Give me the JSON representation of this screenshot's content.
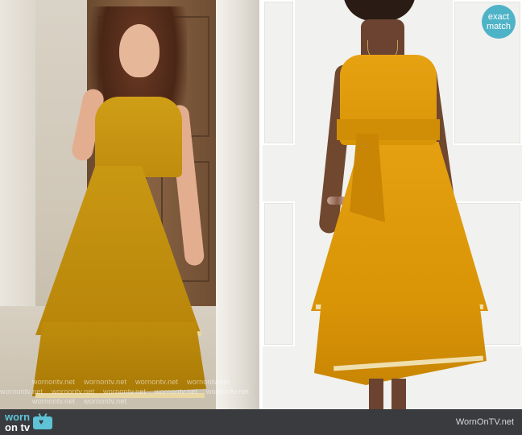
{
  "badge": {
    "line1": "exact",
    "line2": "match"
  },
  "watermark": {
    "text_a": "wornontv.net",
    "text_b": "wornontv.net",
    "text_c": "wornontv.net",
    "text_d": "wornontv.net",
    "text_e": "wornontv.net",
    "text_f": "wornontv.net",
    "text_g": "wornontv.net",
    "text_h": "wornontv.net",
    "text_i": "wornontv.net",
    "text_j": "wornontv.net",
    "text_k": "wornontv.net"
  },
  "footer": {
    "logo_top": "worn",
    "logo_bottom": "on tv",
    "site": "WornOnTV.net"
  },
  "colors": {
    "badge": "#4fb3c8",
    "footer_bg": "#393b3f",
    "logo_accent": "#5ec3d6",
    "dress_left": "#c08c0e",
    "dress_right": "#e0a010"
  },
  "icons": [
    "tv-heart-icon"
  ]
}
